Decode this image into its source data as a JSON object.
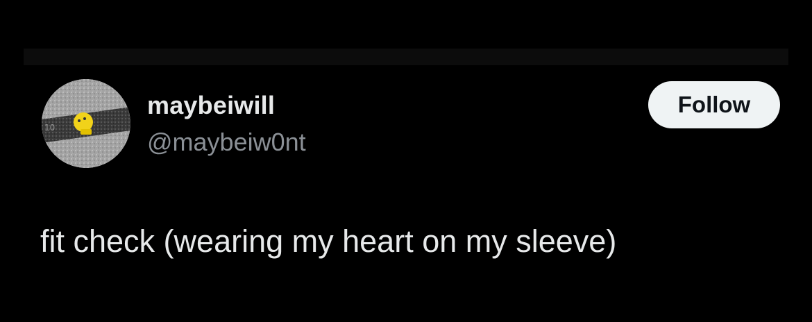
{
  "post": {
    "author": {
      "display_name": "maybeiwill",
      "handle": "@maybeiw0nt",
      "avatar_icon": "avatar-photo-yellow-toy-on-pavement"
    },
    "follow_label": "Follow",
    "text": "fit check (wearing my heart on my sleeve)"
  },
  "colors": {
    "background": "#000000",
    "primary_text": "#e7e9ea",
    "secondary_text": "#8b9096",
    "follow_bg": "#eff3f4",
    "follow_text": "#0f1419"
  }
}
